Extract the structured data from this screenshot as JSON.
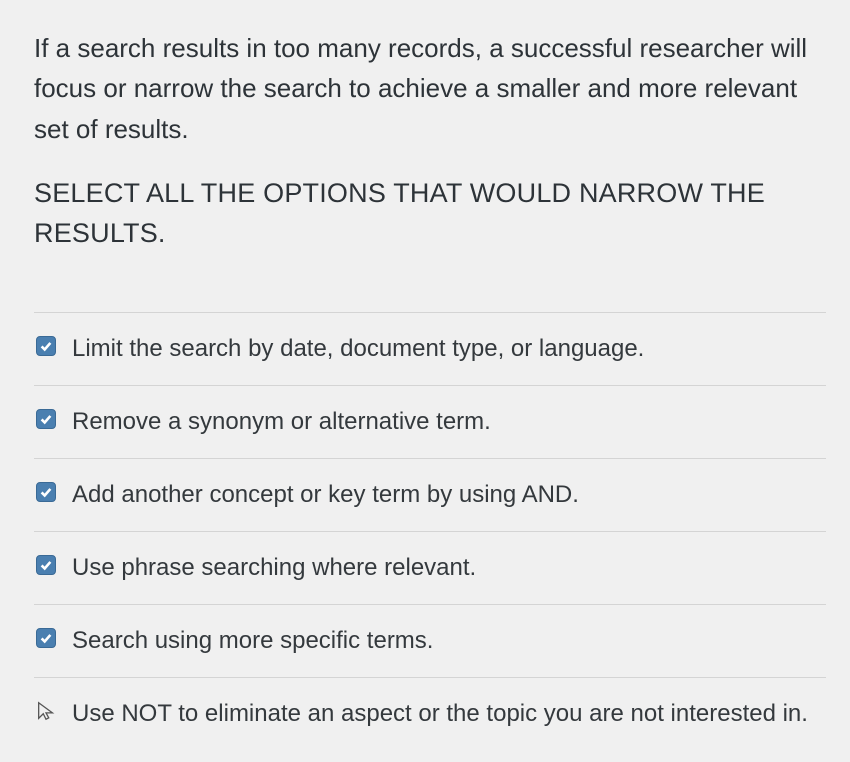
{
  "question": {
    "stem": "If a search results in too many records, a successful researcher will focus or narrow the search to achieve a smaller and more relevant set of results.",
    "instruction": "SELECT ALL THE OPTIONS THAT WOULD NARROW THE RESULTS."
  },
  "options": [
    {
      "label": "Limit the search by date, document type, or language.",
      "checked": true
    },
    {
      "label": "Remove a synonym or alternative term.",
      "checked": true
    },
    {
      "label": "Add another concept or key term by using AND.",
      "checked": true
    },
    {
      "label": "Use phrase searching where relevant.",
      "checked": true
    },
    {
      "label": "Search using more specific terms.",
      "checked": true
    },
    {
      "label": "Use NOT to eliminate an aspect or the topic you are not interested in.",
      "checked": false
    }
  ]
}
